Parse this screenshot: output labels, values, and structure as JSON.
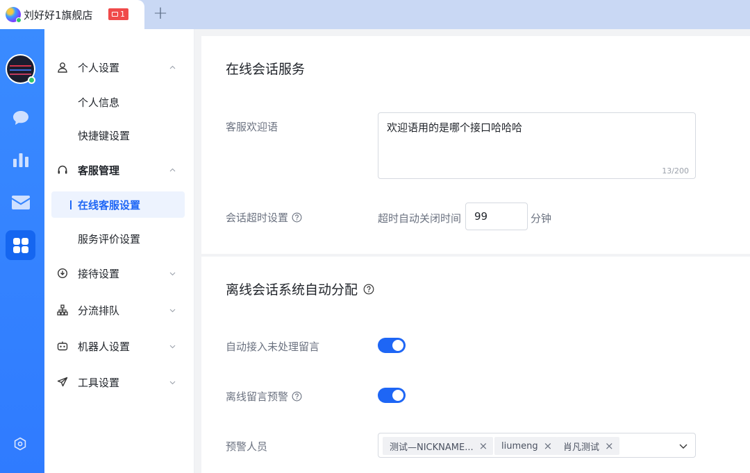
{
  "tabbar": {
    "tab_title": "刘好好1旗舰店",
    "badge_count": "1",
    "add_label": "+"
  },
  "rail": {
    "items": [
      "chat-icon",
      "stats-icon",
      "mail-icon",
      "apps-icon"
    ],
    "active": "apps-icon",
    "settings_icon": "settings-hex-icon"
  },
  "sidebar": {
    "personal": {
      "label": "个人设置",
      "items": [
        "个人信息",
        "快捷键设置"
      ]
    },
    "service": {
      "label": "客服管理",
      "items": [
        "在线客服设置",
        "服务评价设置"
      ],
      "active": "在线客服设置"
    },
    "reception": {
      "label": "接待设置"
    },
    "routing": {
      "label": "分流排队"
    },
    "robot": {
      "label": "机器人设置"
    },
    "tools": {
      "label": "工具设置"
    }
  },
  "online": {
    "title": "在线会话服务",
    "welcome_label": "客服欢迎语",
    "welcome_text": "欢迎语用的是哪个接口哈哈哈",
    "welcome_counter": "13/200",
    "timeout_label": "会话超时设置",
    "timeout_prefix": "超时自动关闭时间",
    "timeout_value": "99",
    "timeout_unit": "分钟"
  },
  "offline": {
    "title": "离线会话系统自动分配",
    "auto_accept_label": "自动接入未处理留言",
    "auto_accept_on": true,
    "warning_label": "离线留言预警",
    "warning_on": true,
    "warning_people_label": "预警人员",
    "warning_people": [
      "测试—NICKNAME...",
      "liumeng",
      "肖凡测试"
    ]
  },
  "colors": {
    "accent": "#1e66f5",
    "rail": "#2f7bff",
    "badge": "#f04a4a",
    "online": "#31c46b"
  }
}
